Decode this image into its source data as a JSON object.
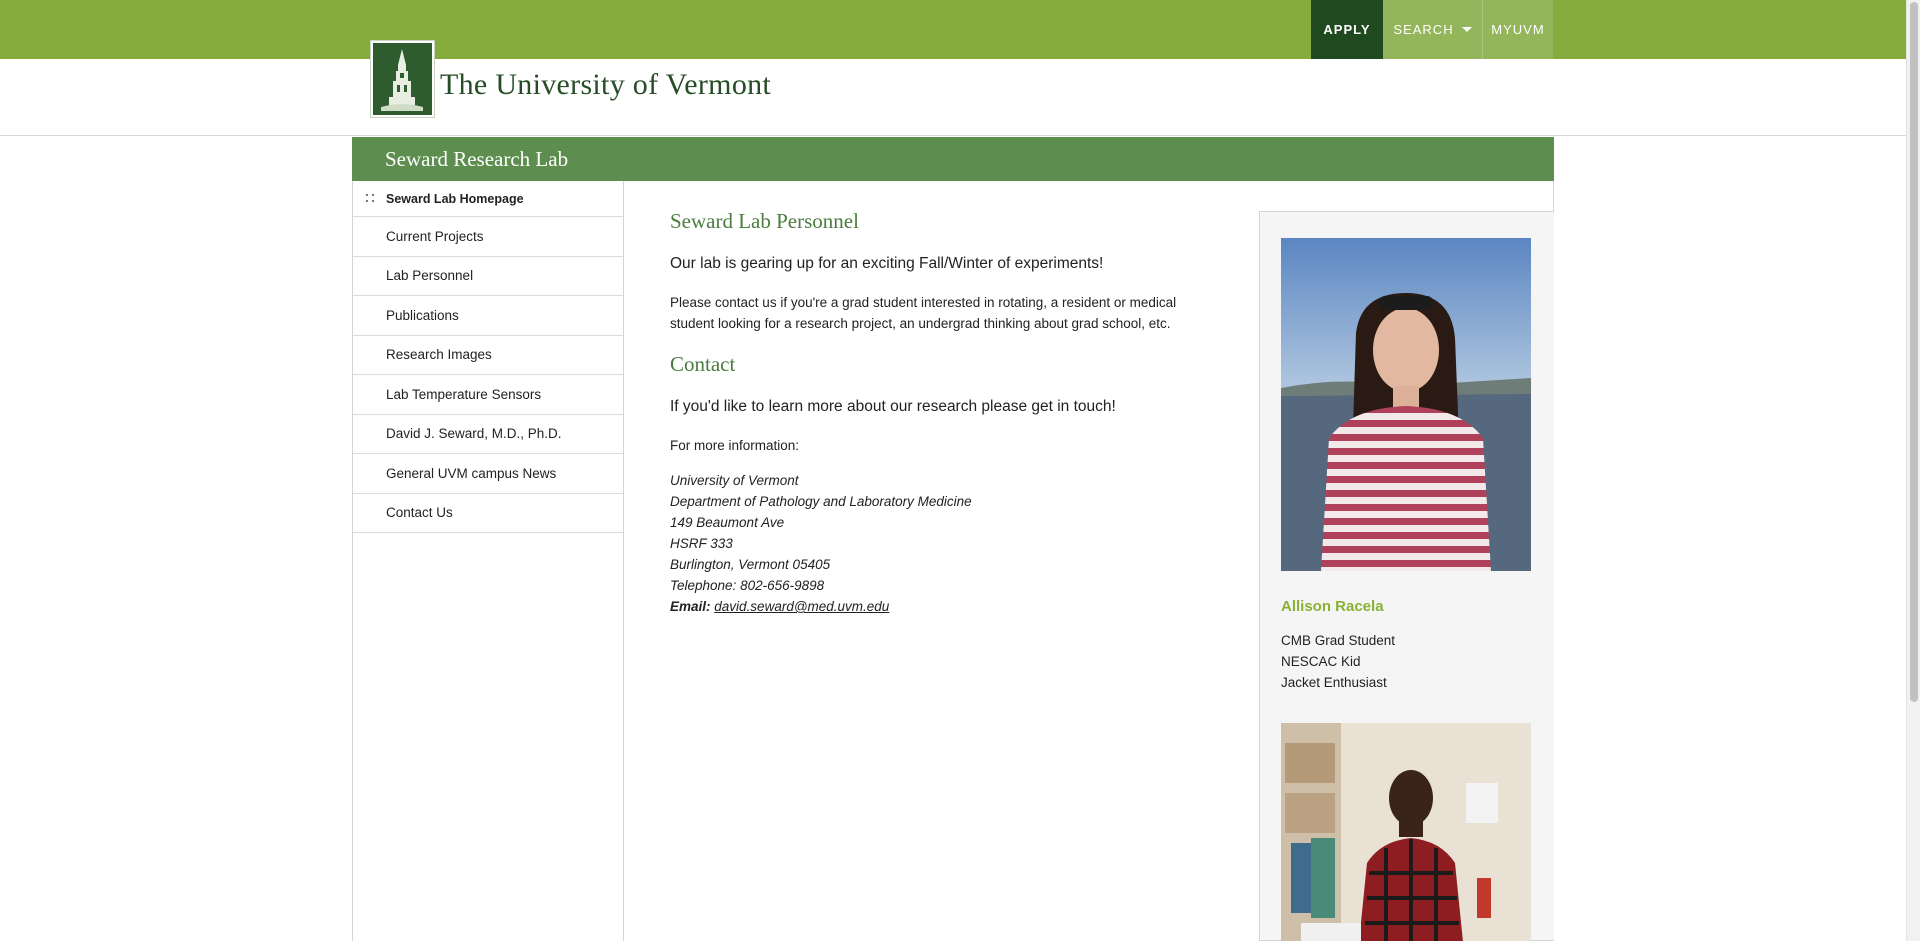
{
  "topnav": {
    "apply": "APPLY",
    "search": "SEARCH",
    "myuvm": "MYUVM"
  },
  "header": {
    "logo_text": "The University of Vermont"
  },
  "site": {
    "title": "Seward Research Lab"
  },
  "sidebar": {
    "items": [
      {
        "label": "Seward Lab Homepage",
        "active": true
      },
      {
        "label": "Current Projects"
      },
      {
        "label": "Lab Personnel"
      },
      {
        "label": "Publications"
      },
      {
        "label": "Research Images"
      },
      {
        "label": "Lab Temperature Sensors"
      },
      {
        "label": "David J. Seward, M.D., Ph.D."
      },
      {
        "label": "General UVM campus News"
      },
      {
        "label": "Contact Us"
      }
    ]
  },
  "main": {
    "personnel_heading": "Seward Lab Personnel",
    "intro": "Our lab is gearing up for an exciting Fall/Winter of experiments!",
    "contact_text_1": "Please contact us if you're a grad student interested in rotating, a resident or medical",
    "contact_text_2": "student looking for a research project, an undergrad thinking about grad school, etc.",
    "contact_heading": "Contact",
    "get_in_touch": "If you'd like to learn more about our research please get in touch!",
    "more_info": "For more information:",
    "address": {
      "line1": "University of Vermont",
      "line2": "Department of Pathology and Laboratory Medicine",
      "line3": "149 Beaumont Ave",
      "line4": "HSRF 333",
      "line5": "Burlington, Vermont 05405",
      "line6": "Telephone: 802-656-9898",
      "email_label": "Email:",
      "email": "david.seward@med.uvm.edu"
    }
  },
  "profiles": [
    {
      "name": "Allison Racela",
      "lines": [
        "CMB Grad Student",
        "NESCAC Kid",
        "Jacket Enthusiast"
      ]
    }
  ],
  "colors": {
    "topbar": "#84ac3c",
    "apply_bg": "#1f4a1f",
    "site_bar": "#5e8e4f",
    "heading_green": "#4a7c3f",
    "name_green": "#8ab135"
  }
}
